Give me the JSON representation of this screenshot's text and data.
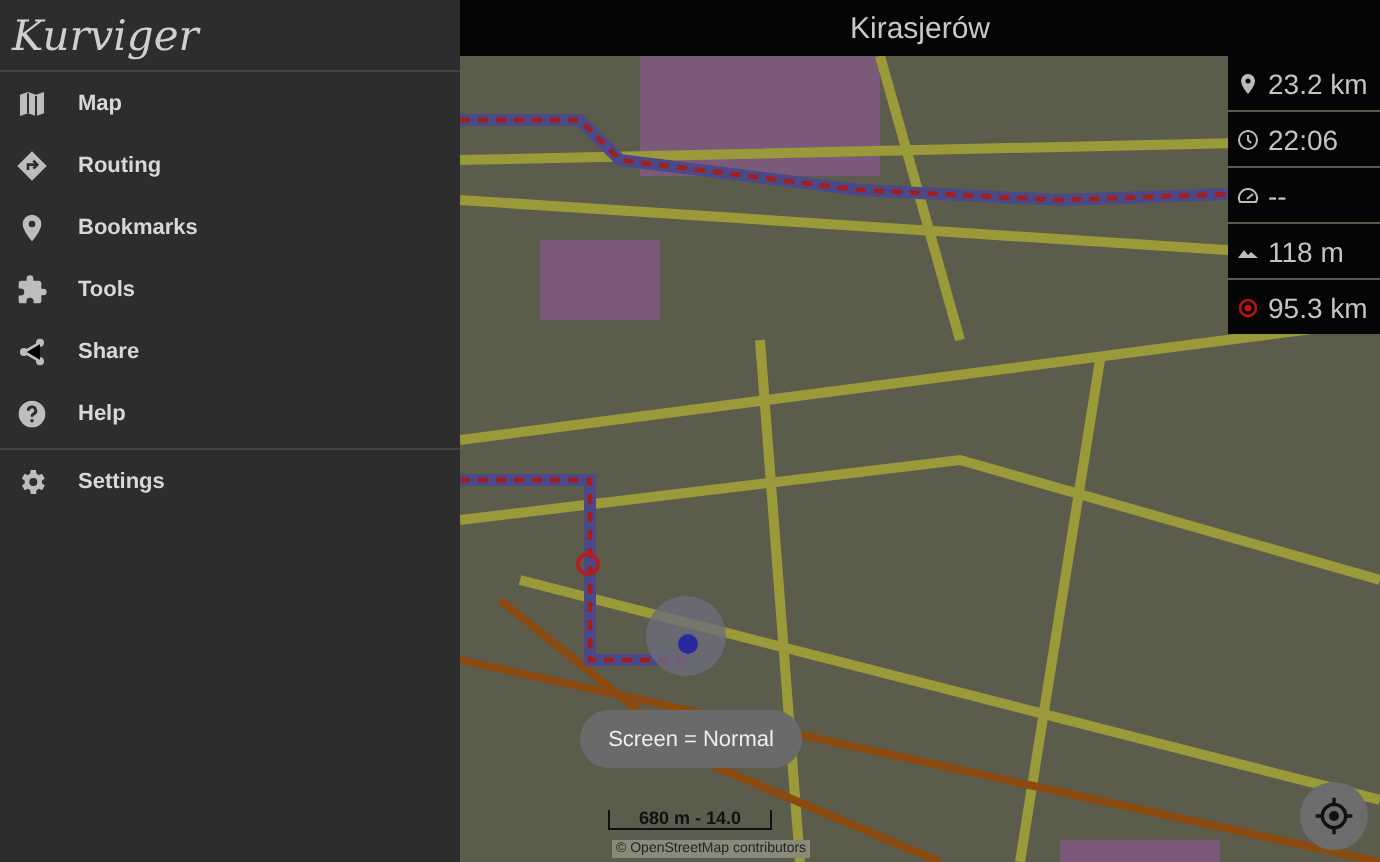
{
  "sidebar": {
    "logo": "Kurviger",
    "items": [
      {
        "kind": "map",
        "label": "Map"
      },
      {
        "kind": "routing",
        "label": "Routing"
      },
      {
        "kind": "bookmarks",
        "label": "Bookmarks"
      },
      {
        "kind": "tools",
        "label": "Tools"
      },
      {
        "kind": "share",
        "label": "Share"
      },
      {
        "kind": "help",
        "label": "Help"
      },
      {
        "kind": "settings",
        "label": "Settings"
      }
    ]
  },
  "map": {
    "title": "Kirasjerów",
    "stats": [
      {
        "kind": "distance",
        "value": "23.2 km"
      },
      {
        "kind": "time",
        "value": "22:06"
      },
      {
        "kind": "speed",
        "value": "--"
      },
      {
        "kind": "elevation",
        "value": "118 m"
      },
      {
        "kind": "remaining",
        "value": "95.3 km"
      }
    ],
    "toast": "Screen = Normal",
    "scale": "680 m - 14.0",
    "attribution": "© OpenStreetMap contributors"
  }
}
